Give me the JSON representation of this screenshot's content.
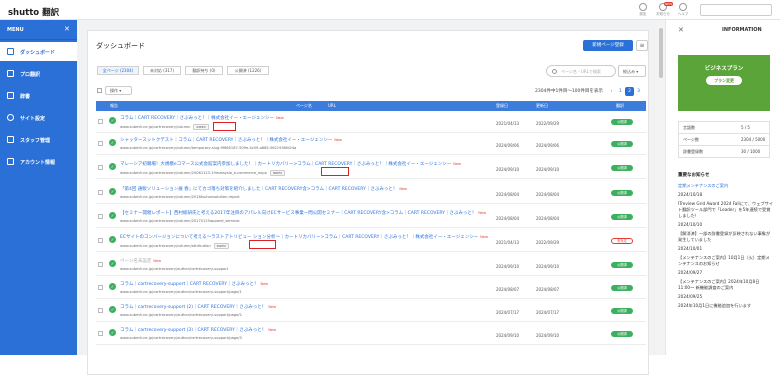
{
  "app": {
    "logo": "shutto 翻訳"
  },
  "topbar": {
    "icons": [
      {
        "name": "settings",
        "label": "設定"
      },
      {
        "name": "notice",
        "label": "お知らせ",
        "badge": "NEW"
      },
      {
        "name": "help",
        "label": "ヘルプ"
      }
    ]
  },
  "sidebar": {
    "header": "MENU",
    "items": [
      {
        "label": "ダッシュボード",
        "icon": "dashboard-icon",
        "active": true
      },
      {
        "label": "プロ翻訳",
        "icon": "translate-icon"
      },
      {
        "label": "辞書",
        "icon": "dictionary-icon"
      },
      {
        "label": "サイト設定",
        "icon": "gear-icon"
      },
      {
        "label": "スタッフ管理",
        "icon": "people-icon"
      },
      {
        "label": "アカウント情報",
        "icon": "document-icon"
      }
    ]
  },
  "main": {
    "title": "ダッシュボード",
    "add_button": "新規ページ登録",
    "tabs": [
      {
        "label": "全ページ (2304)",
        "active": true
      },
      {
        "label": "未対応 (317)"
      },
      {
        "label": "翻訳待ち (0)"
      },
      {
        "label": "公開済 (1226)"
      }
    ],
    "search_placeholder": "ページ名・URLで検索",
    "filter_label": "絞込み",
    "bulk_label": "操作",
    "count_text": "2304件中1件目〜100件目を表示",
    "pages": [
      "1",
      "2",
      "3",
      "…",
      "24"
    ],
    "headers": {
      "status": "報告",
      "name": "ページ名",
      "url": "URL",
      "registered": "登録日",
      "updated": "更新日",
      "state": "翻訳"
    },
    "rows": [
      {
        "title": "コラム｜CART RECOVERY｜さぶみっと！｜株式会社イー・エージェンシー",
        "new": "New",
        "url": "www.submit.ne.jp/cartrecovery/column",
        "index": "INDEX",
        "reg": "2021/04/13",
        "upd": "2022/09/29",
        "state": "公開済"
      },
      {
        "title": "シャッタースットクデスト｜コラム｜CART RECOVERY｜さぶみっと！｜株式会社イー・エージェンシー",
        "new": "New",
        "url": "www.submit.ne.jp/cartrecovery/column/temporary-slug-9f665187-509e-4c59-a885-0621936fd24a",
        "reg": "2024/09/06",
        "upd": "2024/09/06",
        "state": "公開済"
      },
      {
        "title": "マレーシア初職場！大規模eコマース公式会館案内参加しました！｜カートリカバリー>コラム｜CART RECOVERY｜さぶみっと！｜株式会社イー・エージェンシー",
        "new": "New",
        "url": "www.submit.ne.jp/cartrecovery/column/20061123-19malaysia_e-commerce_expo",
        "index": "INDEX",
        "reg": "2024/09/10",
        "upd": "2024/09/10",
        "state": "公開済"
      },
      {
        "title": "「第4回 通販ソリューション展 春」にてカゴ落ち対策を紹介しました｜CART RECOVERY含>コラム｜CART RECOVERY｜さぶみっと！",
        "new": "New",
        "url": "www.submit.ne.jp/cartrecovery/column/2018tsuhansolution-report",
        "reg": "2024/08/04",
        "upd": "2024/08/04",
        "state": "公開済"
      },
      {
        "title": "【セミナー開催レポート】西村総研氏と考える2017年注目のアパレル向けECサービス事業ー問公開セミナー｜CART RECOVERY含>コラム｜CART RECOVERY｜さぶみっと！",
        "new": "New",
        "url": "www.submit.ne.jp/cartrecovery/column/20170125apparel_seminar",
        "reg": "2024/08/04",
        "upd": "2024/08/04",
        "state": "公開済"
      },
      {
        "title": "ECサイトのコンバージョンについて考える〜ラストアトリビュー ション分析〜｜カートリカバリー>コラム｜CART RECOVERY｜さぶみっと！｜株式会社イー・エージェンシー",
        "new": "New",
        "url": "www.submit.ne.jp/cartrecovery/column/attribution",
        "index": "INDEX",
        "reg": "2021/04/13",
        "upd": "2022/09/29",
        "state": "未対応",
        "state_red": true
      },
      {
        "title": "ページ名未設定",
        "new": "New",
        "url": "www.submit.ne.jp/cartrecovery/author/cartrecovery-support",
        "gray": true,
        "reg": "2024/09/10",
        "upd": "2024/09/10",
        "state": "公開済"
      },
      {
        "title": "コラム｜cartrecovery-support｜CART RECOVERY｜さぶみっと！",
        "new": "New",
        "url": "www.submit.ne.jp/cartrecovery/author/cartrecovery-support/page/1",
        "reg": "2024/08/07",
        "upd": "2024/08/07",
        "state": "公開済"
      },
      {
        "title": "コラム｜cartrecovery-support (2)｜CART RECOVERY｜さぶみっと！",
        "new": "New",
        "url": "www.submit.ne.jp/cartrecovery/author/cartrecovery-support/page/2",
        "reg": "2024/07/17",
        "upd": "2024/07/17",
        "state": "公開済"
      },
      {
        "title": "コラム｜cartrecovery-support (3)｜CART RECOVERY｜さぶみっと！",
        "new": "New",
        "url": "www.submit.ne.jp/cartrecovery/author/cartrecovery-support/page/3",
        "reg": "2024/09/10",
        "upd": "2024/09/10",
        "state": "公開済"
      }
    ]
  },
  "info": {
    "title": "INFORMATION",
    "plan_name": "ビジネスプラン",
    "plan_button": "プラン変更",
    "stats": [
      {
        "k": "言語数",
        "v": "5 / 5"
      },
      {
        "k": "ページ数",
        "v": "2304 / 5000"
      },
      {
        "k": "辞書登録数",
        "v": "30 / 1000"
      }
    ],
    "news_title": "重要なお知らせ",
    "news": [
      {
        "text": "定期メンテナンスのご案内",
        "link": true
      },
      {
        "text": "2024/10/18"
      },
      {
        "text": "ITreview Grid Award 2024 Fallにて、ウェブサイト翻訳ツール部門で「Leader」を5年連続で受賞しました！"
      },
      {
        "text": "2024/10/10"
      },
      {
        "text": "【解消済】一部の辞書登録が反映されない事象が発生していました"
      },
      {
        "text": "2024/10/01"
      },
      {
        "text": "【メンテナンスのご案内】10月1日（火）定期メンテナンスのお知らせ"
      },
      {
        "text": "2024/09/27"
      },
      {
        "text": "【メンテナンスのご案内】2024年10月8日 11:00〜 新機能調査のご案内"
      },
      {
        "text": "2024/09/25"
      },
      {
        "text": "2024年10月1日に機能追加を行います"
      }
    ]
  }
}
